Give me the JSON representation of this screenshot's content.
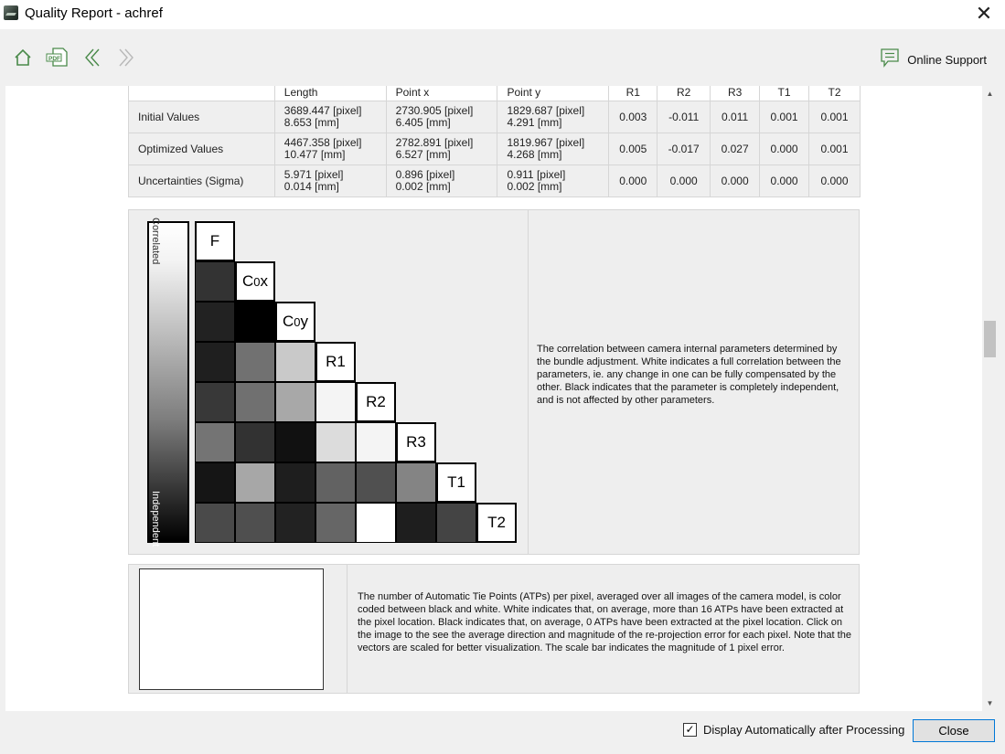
{
  "window": {
    "title": "Quality Report - achref"
  },
  "toolbar": {
    "home_icon": "home-icon",
    "pdf_icon": "pdf-icon",
    "back_icon": "back-icon",
    "forward_icon": "forward-icon",
    "support_label": "Online Support"
  },
  "table": {
    "headers": [
      "",
      "Length",
      "Point x",
      "Point y",
      "R1",
      "R2",
      "R3",
      "T1",
      "T2"
    ],
    "rows": [
      {
        "label": "Initial Values",
        "length": [
          "3689.447 [pixel]",
          "8.653 [mm]"
        ],
        "point_x": [
          "2730.905 [pixel]",
          "6.405 [mm]"
        ],
        "point_y": [
          "1829.687 [pixel]",
          "4.291 [mm]"
        ],
        "r1": "0.003",
        "r2": "-0.011",
        "r3": "0.011",
        "t1": "0.001",
        "t2": "0.001"
      },
      {
        "label": "Optimized Values",
        "length": [
          "4467.358 [pixel]",
          "10.477 [mm]"
        ],
        "point_x": [
          "2782.891 [pixel]",
          "6.527 [mm]"
        ],
        "point_y": [
          "1819.967 [pixel]",
          "4.268 [mm]"
        ],
        "r1": "0.005",
        "r2": "-0.017",
        "r3": "0.027",
        "t1": "0.000",
        "t2": "0.001"
      },
      {
        "label": "Uncertainties (Sigma)",
        "length": [
          "5.971 [pixel]",
          "0.014 [mm]"
        ],
        "point_x": [
          "0.896 [pixel]",
          "0.002 [mm]"
        ],
        "point_y": [
          "0.911 [pixel]",
          "0.002 [mm]"
        ],
        "r1": "0.000",
        "r2": "0.000",
        "r3": "0.000",
        "t1": "0.000",
        "t2": "0.000"
      }
    ]
  },
  "correlation": {
    "scale_top": "Correlated",
    "scale_bottom": "Independent",
    "parameters": [
      "F",
      "C0x",
      "C0y",
      "R1",
      "R2",
      "R3",
      "T1",
      "T2"
    ],
    "labels": [
      {
        "main": "F",
        "sub": "",
        "tail": ""
      },
      {
        "main": "C",
        "sub": "0",
        "tail": "x"
      },
      {
        "main": "C",
        "sub": "0",
        "tail": "y"
      },
      {
        "main": "R1",
        "sub": "",
        "tail": ""
      },
      {
        "main": "R2",
        "sub": "",
        "tail": ""
      },
      {
        "main": "R3",
        "sub": "",
        "tail": ""
      },
      {
        "main": "T1",
        "sub": "",
        "tail": ""
      },
      {
        "main": "T2",
        "sub": "",
        "tail": ""
      }
    ],
    "lower_triangle_colors": [
      [
        "#333333"
      ],
      [
        "#222222",
        "#000000"
      ],
      [
        "#1f1f1f",
        "#717171",
        "#c9c9c9"
      ],
      [
        "#383838",
        "#707070",
        "#a8a8a8",
        "#f4f4f4"
      ],
      [
        "#747474",
        "#323232",
        "#111111",
        "#dcdcdc",
        "#f4f4f4"
      ],
      [
        "#151515",
        "#a7a7a7",
        "#1e1e1e",
        "#626262",
        "#505050",
        "#848484"
      ],
      [
        "#4a4a4a",
        "#4f4f4f",
        "#222222",
        "#666666",
        "#ffffff",
        "#1e1e1e",
        "#444444"
      ]
    ],
    "description": "The correlation between camera internal parameters determined by the bundle adjustment. White indicates a full correlation between the parameters, ie. any change in one can be fully compensated by the other. Black indicates that the parameter is completely independent, and is not affected by other parameters."
  },
  "atp": {
    "description": "The number of Automatic Tie Points (ATPs) per pixel, averaged over all images of the camera model, is color coded between black and white. White indicates that, on average, more than 16 ATPs have been extracted at the pixel location. Black indicates that, on average, 0 ATPs have been extracted at the pixel location. Click on the image to the see the average direction and magnitude of the re-projection error for each pixel. Note that the vectors are scaled for better visualization. The scale bar indicates the magnitude of 1 pixel error."
  },
  "footer": {
    "checkbox_label": "Display Automatically after Processing",
    "checkbox_checked": true,
    "close_label": "Close"
  }
}
